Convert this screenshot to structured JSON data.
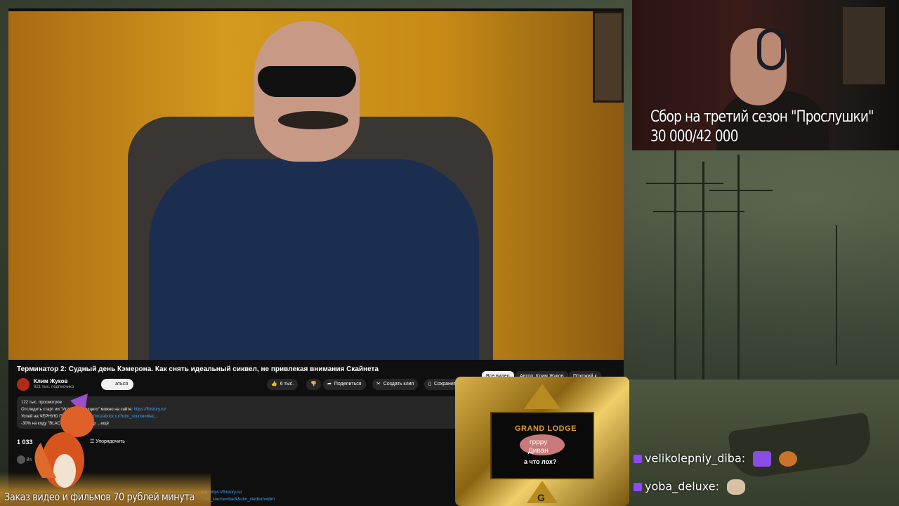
{
  "video": {
    "title": "Терминатор 2: Судный день Кэмерона. Как снять идеальный сиквел, не привлекая внимания Скайнета",
    "channel_name": "Клим Жуков",
    "channel_subs": "921 тыс. подписчико",
    "subscribe_label": "аться",
    "likes": "6 тыс.",
    "share_label": "Поделиться",
    "clip_label": "Создать клип",
    "save_label": "Сохранить"
  },
  "chips": [
    {
      "label": "Все видео",
      "active": true
    },
    {
      "label": "Автор: Клим Жуков",
      "active": false
    },
    {
      "label": "Похожий к",
      "active": false
    }
  ],
  "description": {
    "views": "122 тыс. просмотров",
    "line1_prefix": "Отследить старт",
    "line1_mid": "ии \"История будущего\" можно на сайте:",
    "line1_link": "https://fhistory.ru/",
    "line2_prefix": "Успей на",
    "line2_mid": "ЧЕРНУЮ ПЯТНИЦУ:",
    "line2_link": "https://mozabrick.ru/?utm_source=blac...",
    "line3_prefix": "-30% на",
    "line3_mid": "коду \"BLACK\" до конца ноябр",
    "line3_more": "...ещё"
  },
  "comments": {
    "count": "1 033",
    "sort_label": "Упорядочить",
    "row1_text": "Ва",
    "link1": "йте: https://fhistory.ru/",
    "link2": "?utm_source=black&utm_medium=klim"
  },
  "stream": {
    "fundraise_title": "Сбор на третий сезон \"Прослушки\"",
    "fundraise_progress": "30 000/42 000",
    "fundraise_raised": 30000,
    "fundraise_goal": 42000,
    "order_banner": "Заказ видео и фильмов 70 рублей минута"
  },
  "lodge": {
    "title": "GRAND LODGE",
    "msg1": "гррру",
    "msg2": "Диван",
    "msg3": "а что лох?",
    "letter": "G"
  },
  "chat": [
    {
      "user": "velikolepniy_diba:",
      "emote1": "purple-emote",
      "emote2": "pineapple-pizza-emote"
    },
    {
      "user": "yoba_deluxe:",
      "emote1": "cat-emote"
    }
  ],
  "colors": {
    "yt_bg": "#0f0f0f",
    "link": "#3ea6ff",
    "twitch": "#9146ff",
    "lodge_title": "#e3962a"
  }
}
